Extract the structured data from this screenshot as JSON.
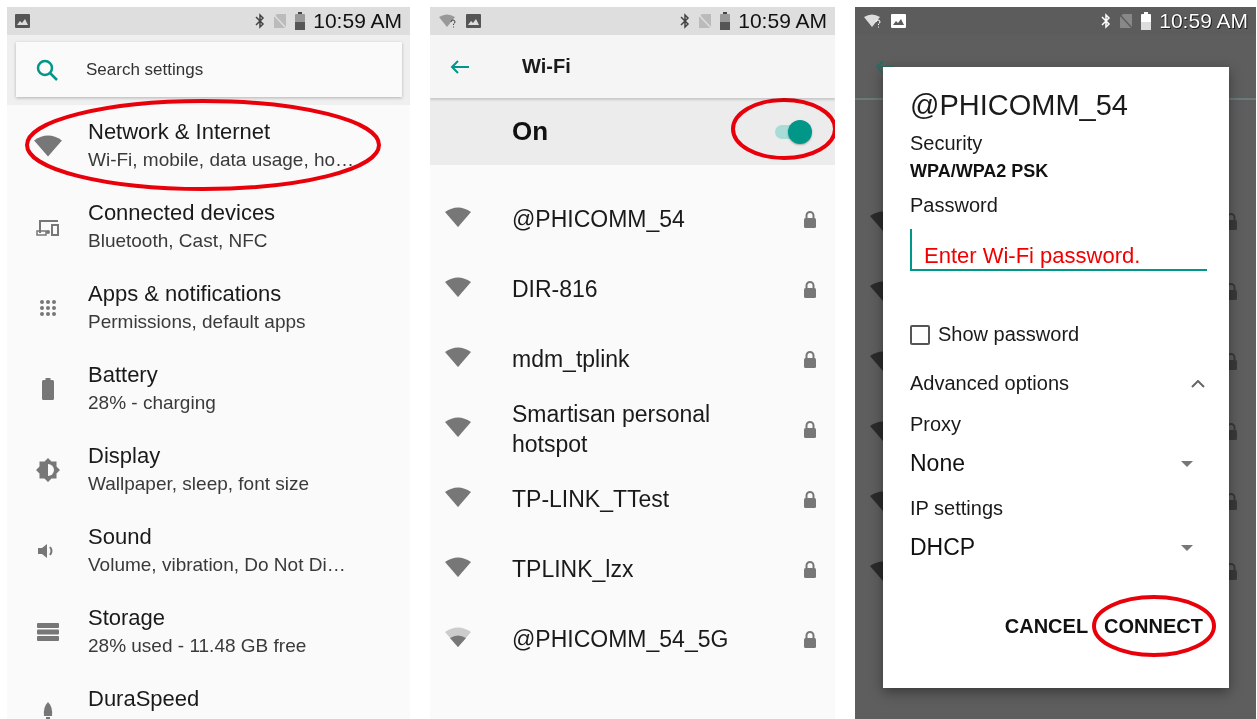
{
  "settings_screen": {
    "status_bar": {
      "time": "10:59 AM"
    },
    "search": {
      "placeholder": "Search settings"
    },
    "items": [
      {
        "title": "Network & Internet",
        "subtitle": "Wi-Fi, mobile, data usage, ho…",
        "highlighted": true
      },
      {
        "title": "Connected devices",
        "subtitle": "Bluetooth, Cast, NFC",
        "highlighted": false
      },
      {
        "title": "Apps & notifications",
        "subtitle": "Permissions, default apps",
        "highlighted": false
      },
      {
        "title": "Battery",
        "subtitle": "28% - charging",
        "highlighted": false
      },
      {
        "title": "Display",
        "subtitle": "Wallpaper, sleep, font size",
        "highlighted": false
      },
      {
        "title": "Sound",
        "subtitle": "Volume, vibration, Do Not Di…",
        "highlighted": false
      },
      {
        "title": "Storage",
        "subtitle": "28% used - 11.48 GB free",
        "highlighted": false
      },
      {
        "title": "DuraSpeed",
        "highlighted": false
      }
    ]
  },
  "wifi_screen": {
    "status_bar": {
      "time": "10:59 AM"
    },
    "title": "Wi-Fi",
    "toggle": {
      "label": "On",
      "on": true,
      "highlighted": true
    },
    "networks": [
      {
        "name": "@PHICOMM_54",
        "weak_signal": false
      },
      {
        "name": "DIR-816",
        "weak_signal": false
      },
      {
        "name": "mdm_tplink",
        "weak_signal": false
      },
      {
        "name": "Smartisan personal hotspot",
        "weak_signal": false
      },
      {
        "name": "TP-LINK_TTest",
        "weak_signal": false
      },
      {
        "name": "TPLINK_lzx",
        "weak_signal": false
      },
      {
        "name": "@PHICOMM_54_5G",
        "weak_signal": true
      }
    ]
  },
  "dialog_screen": {
    "status_bar": {
      "time": "10:59 AM"
    },
    "dialog": {
      "title": "@PHICOMM_54",
      "security_label": "Security",
      "security_value": "WPA/WPA2 PSK",
      "password_label": "Password",
      "password_placeholder": "Enter Wi-Fi password.",
      "show_password": {
        "label": "Show password",
        "checked": false
      },
      "advanced": {
        "label": "Advanced options",
        "expanded": true
      },
      "proxy_label": "Proxy",
      "proxy_value": "None",
      "ip_label": "IP settings",
      "ip_value": "DHCP",
      "buttons": [
        {
          "label": "CANCEL",
          "highlighted": false
        },
        {
          "label": "CONNECT",
          "highlighted": true
        }
      ]
    }
  }
}
